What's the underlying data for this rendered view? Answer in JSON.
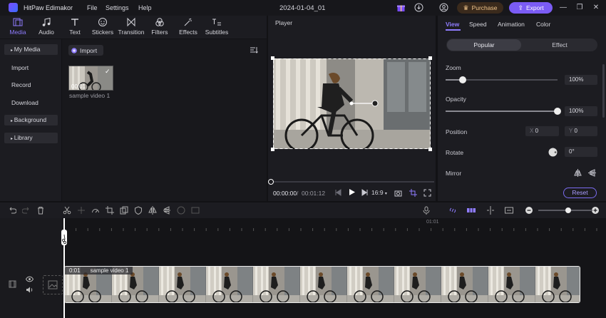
{
  "app": {
    "name": "HitPaw Edimakor",
    "doc_title": "2024-01-04_01"
  },
  "menu": [
    "File",
    "Settings",
    "Help"
  ],
  "header_buttons": {
    "purchase": "Purchase",
    "export": "Export"
  },
  "toolbar": [
    {
      "label": "Media",
      "icon": "media-icon",
      "active": true
    },
    {
      "label": "Audio",
      "icon": "music-note-icon",
      "active": false
    },
    {
      "label": "Text",
      "icon": "text-icon",
      "active": false
    },
    {
      "label": "Stickers",
      "icon": "sticker-icon",
      "active": false
    },
    {
      "label": "Transition",
      "icon": "transition-icon",
      "active": false
    },
    {
      "label": "Filters",
      "icon": "filter-icon",
      "active": false
    },
    {
      "label": "Effects",
      "icon": "effects-icon",
      "active": false
    },
    {
      "label": "Subtitles",
      "icon": "subtitles-icon",
      "active": false
    }
  ],
  "leftnav": {
    "my_media": "My Media",
    "import": "Import",
    "record": "Record",
    "download": "Download",
    "background": "Background",
    "library": "Library"
  },
  "media": {
    "import_label": "Import",
    "items": [
      {
        "name": "sample video 1",
        "duration": "00:01",
        "selected": true
      }
    ]
  },
  "player": {
    "title": "Player",
    "current_time": "00:00:00",
    "total_time": "00:01:12",
    "aspect": "16:9",
    "progress": 0
  },
  "properties": {
    "tabs": [
      "View",
      "Speed",
      "Animation",
      "Color"
    ],
    "active_tab": "View",
    "segments": [
      "Popular",
      "Effect"
    ],
    "zoom": {
      "label": "Zoom",
      "value": "100%",
      "level": 0.15
    },
    "opacity": {
      "label": "Opacity",
      "value": "100%",
      "level": 1.0
    },
    "position": {
      "label": "Position",
      "x_label": "X",
      "x": "0",
      "y_label": "Y",
      "y": "0"
    },
    "rotate": {
      "label": "Rotate",
      "value": "0°"
    },
    "mirror": {
      "label": "Mirror"
    },
    "reset": "Reset"
  },
  "timeline": {
    "ruler_mark": "01:01",
    "zoom_level": 0.55,
    "clip": {
      "time": "0:01",
      "name": "sample video 1"
    }
  },
  "colors": {
    "accent": "#7b5cf5",
    "active_text": "#8f7cff",
    "purchase": "#f0c48a"
  }
}
